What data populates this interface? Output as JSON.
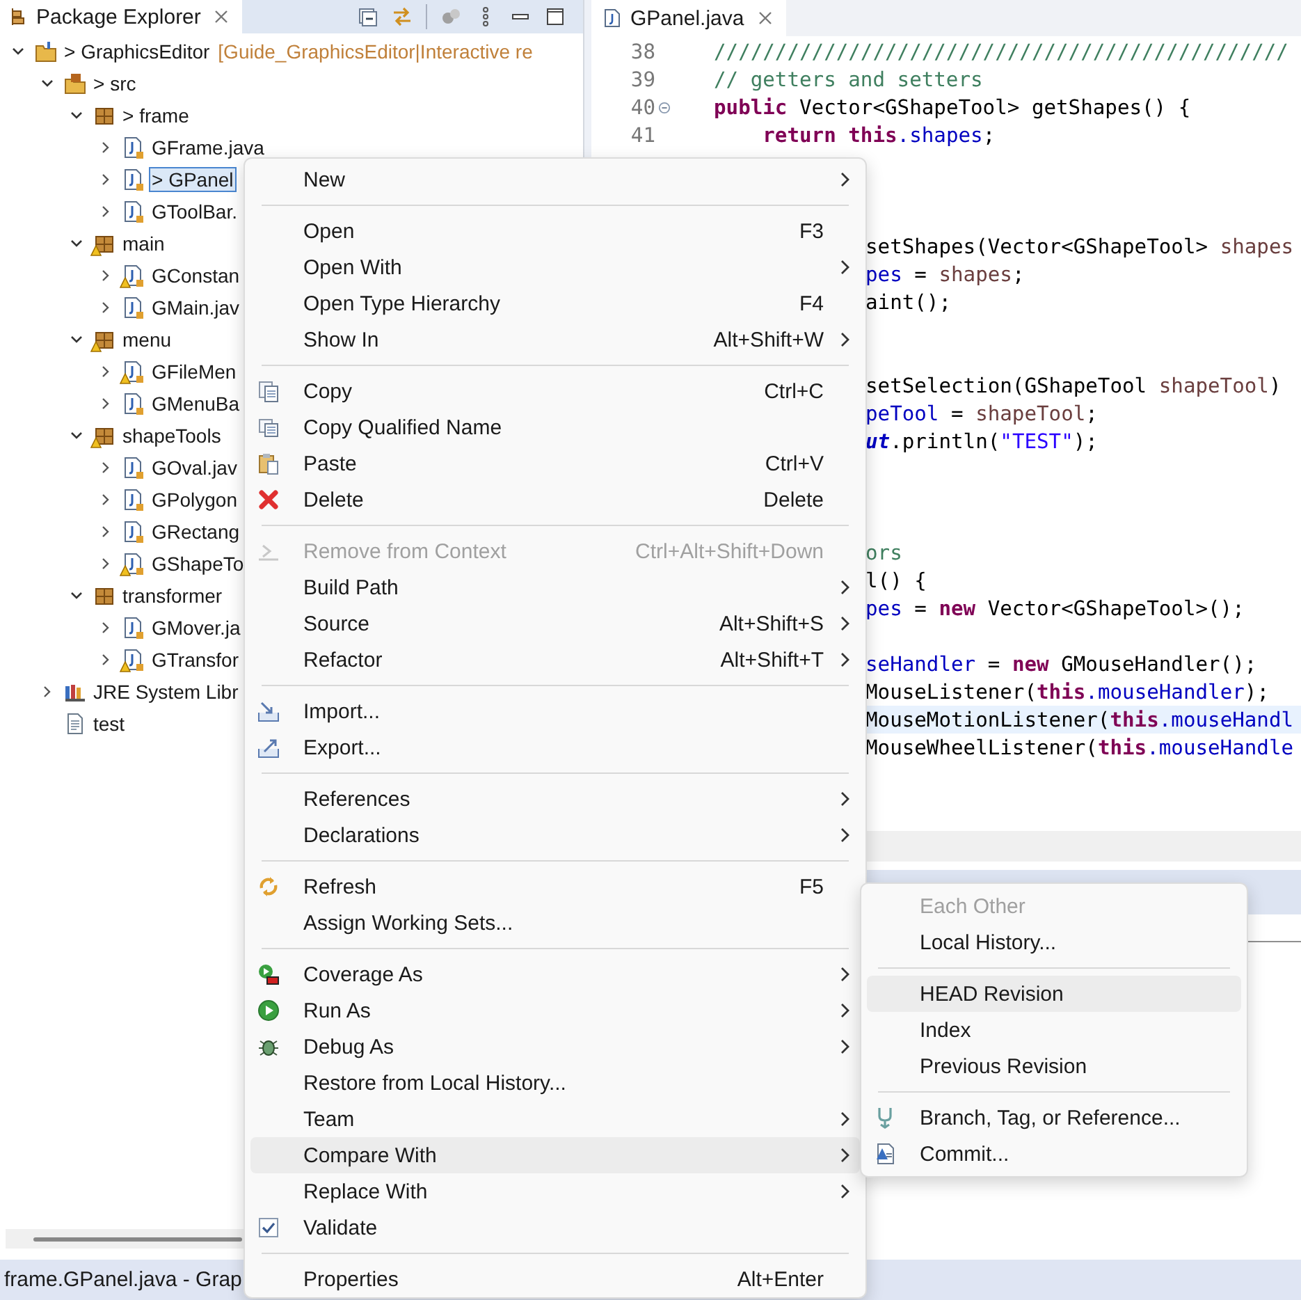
{
  "explorer": {
    "tab": {
      "label": "Package Explorer"
    },
    "tree": [
      {
        "kind": "project",
        "label": "> GraphicsEditor",
        "decoration": "[Guide_GraphicsEditor|Interactive re",
        "expanded": true,
        "selected": false,
        "children": [
          {
            "kind": "source-folder",
            "label": "> src",
            "expanded": true,
            "selected": false,
            "children": [
              {
                "kind": "package",
                "label": "> frame",
                "expanded": true,
                "warning": false,
                "selected": false,
                "children": [
                  {
                    "kind": "java-file",
                    "label": "GFrame.java",
                    "expanded": false,
                    "warning": false,
                    "selected": false
                  },
                  {
                    "kind": "java-file",
                    "label": "> GPanel",
                    "expanded": false,
                    "warning": false,
                    "selected": true
                  },
                  {
                    "kind": "java-file",
                    "label": "GToolBar.",
                    "expanded": false,
                    "warning": false,
                    "selected": false
                  }
                ]
              },
              {
                "kind": "package",
                "label": "main",
                "expanded": true,
                "warning": true,
                "selected": false,
                "children": [
                  {
                    "kind": "java-file",
                    "label": "GConstan",
                    "expanded": false,
                    "warning": true,
                    "selected": false
                  },
                  {
                    "kind": "java-file",
                    "label": "GMain.jav",
                    "expanded": false,
                    "warning": false,
                    "selected": false
                  }
                ]
              },
              {
                "kind": "package",
                "label": "menu",
                "expanded": true,
                "warning": true,
                "selected": false,
                "children": [
                  {
                    "kind": "java-file",
                    "label": "GFileMen",
                    "expanded": false,
                    "warning": true,
                    "selected": false
                  },
                  {
                    "kind": "java-file",
                    "label": "GMenuBa",
                    "expanded": false,
                    "warning": false,
                    "selected": false
                  }
                ]
              },
              {
                "kind": "package",
                "label": "shapeTools",
                "expanded": true,
                "warning": true,
                "selected": false,
                "children": [
                  {
                    "kind": "java-file",
                    "label": "GOval.jav",
                    "expanded": false,
                    "warning": false,
                    "selected": false
                  },
                  {
                    "kind": "java-file",
                    "label": "GPolygon",
                    "expanded": false,
                    "warning": false,
                    "selected": false
                  },
                  {
                    "kind": "java-file",
                    "label": "GRectang",
                    "expanded": false,
                    "warning": false,
                    "selected": false
                  },
                  {
                    "kind": "java-file",
                    "label": "GShapeTo",
                    "expanded": false,
                    "warning": true,
                    "selected": false
                  }
                ]
              },
              {
                "kind": "package",
                "label": "transformer",
                "expanded": true,
                "warning": false,
                "selected": false,
                "children": [
                  {
                    "kind": "java-file",
                    "label": "GMover.ja",
                    "expanded": false,
                    "warning": false,
                    "selected": false
                  },
                  {
                    "kind": "java-file",
                    "label": "GTransfor",
                    "expanded": false,
                    "warning": true,
                    "selected": false
                  }
                ]
              }
            ]
          },
          {
            "kind": "library",
            "label": "JRE System Libr",
            "expanded": false,
            "selected": false
          },
          {
            "kind": "text-file",
            "label": "test",
            "selected": false
          }
        ]
      }
    ]
  },
  "editor": {
    "tab": {
      "label": "GPanel.java"
    },
    "lines": [
      {
        "kind": "full",
        "number": "38",
        "current": false,
        "segments": [
          {
            "kind": "comment",
            "text": "///////////////////////////////////////////////"
          }
        ]
      },
      {
        "kind": "full",
        "number": "39",
        "current": false,
        "segments": [
          {
            "kind": "comment",
            "text": "// getters and setters"
          }
        ]
      },
      {
        "kind": "full",
        "number": "40",
        "current": false,
        "fold": true,
        "segments": [
          {
            "kind": "keyword",
            "text": "public"
          },
          {
            "kind": "plain",
            "text": " Vector<GShapeTool> getShapes() {"
          }
        ]
      },
      {
        "kind": "full",
        "number": "41",
        "current": false,
        "segments": [
          {
            "kind": "keyword",
            "text": "    return this"
          },
          {
            "kind": "field",
            "text": ".shapes"
          },
          {
            "kind": "plain",
            "text": ";"
          }
        ]
      },
      {
        "kind": "blank"
      },
      {
        "kind": "blank"
      },
      {
        "kind": "blank"
      },
      {
        "kind": "clipped",
        "current": false,
        "segments": [
          {
            "kind": "plain",
            "text": "setShapes(Vector<GShapeTool> "
          },
          {
            "kind": "param",
            "text": "shapes"
          }
        ]
      },
      {
        "kind": "clipped",
        "current": false,
        "segments": [
          {
            "kind": "field",
            "text": "pes"
          },
          {
            "kind": "plain",
            "text": " = "
          },
          {
            "kind": "param",
            "text": "shapes"
          },
          {
            "kind": "plain",
            "text": ";"
          }
        ]
      },
      {
        "kind": "clipped",
        "current": false,
        "segments": [
          {
            "kind": "plain",
            "text": "aint();"
          }
        ]
      },
      {
        "kind": "blank"
      },
      {
        "kind": "blank"
      },
      {
        "kind": "clipped",
        "current": false,
        "segments": [
          {
            "kind": "plain",
            "text": "setSelection(GShapeTool "
          },
          {
            "kind": "param",
            "text": "shapeTool"
          },
          {
            "kind": "plain",
            "text": ")"
          }
        ]
      },
      {
        "kind": "clipped",
        "current": false,
        "segments": [
          {
            "kind": "field",
            "text": "peTool"
          },
          {
            "kind": "plain",
            "text": " = "
          },
          {
            "kind": "param",
            "text": "shapeTool"
          },
          {
            "kind": "plain",
            "text": ";"
          }
        ]
      },
      {
        "kind": "clipped",
        "current": false,
        "segments": [
          {
            "kind": "static",
            "text": "ut"
          },
          {
            "kind": "plain",
            "text": ".println("
          },
          {
            "kind": "string",
            "text": "\"TEST\""
          },
          {
            "kind": "plain",
            "text": ");"
          }
        ]
      },
      {
        "kind": "blank"
      },
      {
        "kind": "blank"
      },
      {
        "kind": "blank"
      },
      {
        "kind": "clipped",
        "current": false,
        "segments": [
          {
            "kind": "comment",
            "text": "ors"
          }
        ]
      },
      {
        "kind": "clipped",
        "current": false,
        "segments": [
          {
            "kind": "plain",
            "text": "l() {"
          }
        ]
      },
      {
        "kind": "clipped",
        "current": false,
        "segments": [
          {
            "kind": "field",
            "text": "pes"
          },
          {
            "kind": "plain",
            "text": " = "
          },
          {
            "kind": "keyword",
            "text": "new"
          },
          {
            "kind": "plain",
            "text": " Vector<GShapeTool>();"
          }
        ]
      },
      {
        "kind": "blank"
      },
      {
        "kind": "clipped",
        "current": false,
        "segments": [
          {
            "kind": "field",
            "text": "seHandler"
          },
          {
            "kind": "plain",
            "text": " = "
          },
          {
            "kind": "keyword",
            "text": "new"
          },
          {
            "kind": "plain",
            "text": " GMouseHandler();"
          }
        ]
      },
      {
        "kind": "clipped",
        "current": false,
        "segments": [
          {
            "kind": "plain",
            "text": "MouseListener("
          },
          {
            "kind": "keyword",
            "text": "this"
          },
          {
            "kind": "field",
            "text": ".mouseHandler"
          },
          {
            "kind": "plain",
            "text": ");"
          }
        ]
      },
      {
        "kind": "clipped",
        "current": true,
        "segments": [
          {
            "kind": "plain",
            "text": "MouseMotionListener("
          },
          {
            "kind": "keyword",
            "text": "this"
          },
          {
            "kind": "field",
            "text": ".mouseHandl"
          }
        ]
      },
      {
        "kind": "clipped",
        "current": false,
        "segments": [
          {
            "kind": "plain",
            "text": "MouseWheelListener("
          },
          {
            "kind": "keyword",
            "text": "this"
          },
          {
            "kind": "field",
            "text": ".mouseHandle"
          }
        ]
      }
    ]
  },
  "status_bar": {
    "text": "frame.GPanel.java - Grap"
  },
  "context_menu": {
    "items": [
      {
        "kind": "item",
        "label": "New",
        "submenu": true,
        "disabled": false,
        "selected": false
      },
      {
        "kind": "separator"
      },
      {
        "kind": "item",
        "label": "Open",
        "shortcut": "F3",
        "disabled": false,
        "selected": false
      },
      {
        "kind": "item",
        "label": "Open With",
        "submenu": true,
        "disabled": false,
        "selected": false
      },
      {
        "kind": "item",
        "label": "Open Type Hierarchy",
        "shortcut": "F4",
        "disabled": false,
        "selected": false
      },
      {
        "kind": "item",
        "label": "Show In",
        "shortcut": "Alt+Shift+W",
        "submenu": true,
        "disabled": false,
        "selected": false
      },
      {
        "kind": "separator"
      },
      {
        "kind": "copy",
        "label": "Copy",
        "shortcut": "Ctrl+C",
        "disabled": false,
        "selected": false
      },
      {
        "kind": "copy-name",
        "label": "Copy Qualified Name",
        "disabled": false,
        "selected": false
      },
      {
        "kind": "paste",
        "label": "Paste",
        "shortcut": "Ctrl+V",
        "disabled": false,
        "selected": false
      },
      {
        "kind": "delete",
        "label": "Delete",
        "shortcut": "Delete",
        "disabled": false,
        "selected": false
      },
      {
        "kind": "separator"
      },
      {
        "kind": "remove",
        "label": "Remove from Context",
        "shortcut": "Ctrl+Alt+Shift+Down",
        "disabled": true,
        "selected": false
      },
      {
        "kind": "item",
        "label": "Build Path",
        "submenu": true,
        "disabled": false,
        "selected": false
      },
      {
        "kind": "item",
        "label": "Source",
        "shortcut": "Alt+Shift+S",
        "submenu": true,
        "disabled": false,
        "selected": false
      },
      {
        "kind": "item",
        "label": "Refactor",
        "shortcut": "Alt+Shift+T",
        "submenu": true,
        "disabled": false,
        "selected": false
      },
      {
        "kind": "separator"
      },
      {
        "kind": "import",
        "label": "Import...",
        "disabled": false,
        "selected": false
      },
      {
        "kind": "export",
        "label": "Export...",
        "disabled": false,
        "selected": false
      },
      {
        "kind": "separator"
      },
      {
        "kind": "item",
        "label": "References",
        "submenu": true,
        "disabled": false,
        "selected": false
      },
      {
        "kind": "item",
        "label": "Declarations",
        "submenu": true,
        "disabled": false,
        "selected": false
      },
      {
        "kind": "separator"
      },
      {
        "kind": "refresh",
        "label": "Refresh",
        "shortcut": "F5",
        "disabled": false,
        "selected": false
      },
      {
        "kind": "item",
        "label": "Assign Working Sets...",
        "disabled": false,
        "selected": false
      },
      {
        "kind": "separator"
      },
      {
        "kind": "coverage",
        "label": "Coverage As",
        "submenu": true,
        "disabled": false,
        "selected": false
      },
      {
        "kind": "run",
        "label": "Run As",
        "submenu": true,
        "disabled": false,
        "selected": false
      },
      {
        "kind": "debug",
        "label": "Debug As",
        "submenu": true,
        "disabled": false,
        "selected": false
      },
      {
        "kind": "item",
        "label": "Restore from Local History...",
        "disabled": false,
        "selected": false
      },
      {
        "kind": "item",
        "label": "Team",
        "submenu": true,
        "disabled": false,
        "selected": false
      },
      {
        "kind": "item",
        "label": "Compare With",
        "submenu": true,
        "disabled": false,
        "selected": true
      },
      {
        "kind": "item",
        "label": "Replace With",
        "submenu": true,
        "disabled": false,
        "selected": false
      },
      {
        "kind": "validate",
        "label": "Validate",
        "disabled": false,
        "selected": false
      },
      {
        "kind": "separator"
      },
      {
        "kind": "item",
        "label": "Properties",
        "shortcut": "Alt+Enter",
        "disabled": false,
        "selected": false
      }
    ]
  },
  "submenu": {
    "items": [
      {
        "kind": "item",
        "label": "Each Other",
        "disabled": true,
        "selected": false
      },
      {
        "kind": "item",
        "label": "Local History...",
        "disabled": false,
        "selected": false
      },
      {
        "kind": "separator"
      },
      {
        "kind": "item",
        "label": "HEAD Revision",
        "disabled": false,
        "selected": true
      },
      {
        "kind": "item",
        "label": "Index",
        "disabled": false,
        "selected": false
      },
      {
        "kind": "item",
        "label": "Previous Revision",
        "disabled": false,
        "selected": false
      },
      {
        "kind": "separator"
      },
      {
        "kind": "branch",
        "label": "Branch, Tag, or Reference...",
        "disabled": false,
        "selected": false
      },
      {
        "kind": "commit",
        "label": "Commit...",
        "disabled": false,
        "selected": false
      }
    ]
  }
}
